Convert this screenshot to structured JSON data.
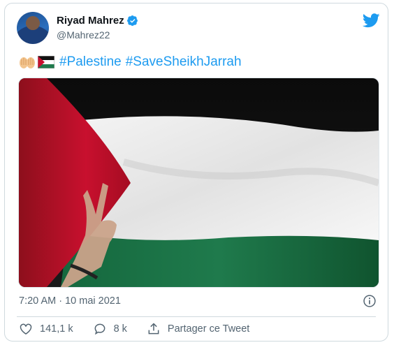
{
  "author": {
    "display_name": "Riyad Mahrez",
    "handle": "@Mahrez22"
  },
  "tweet": {
    "hashtags": [
      "#Palestine",
      "#SaveSheikhJarrah"
    ]
  },
  "meta": {
    "timestamp": "7:20 AM · 10 mai 2021"
  },
  "actions": {
    "likes": "141,1 k",
    "replies": "8 k",
    "share_label": "Partager ce Tweet"
  },
  "colors": {
    "accent": "#1d9bf0",
    "muted": "#536471",
    "flag_red": "#c8102e",
    "flag_green": "#1f7a4c"
  },
  "icons": [
    "verified-badge-icon",
    "twitter-bird-icon",
    "info-icon",
    "heart-icon",
    "reply-icon",
    "share-icon"
  ]
}
